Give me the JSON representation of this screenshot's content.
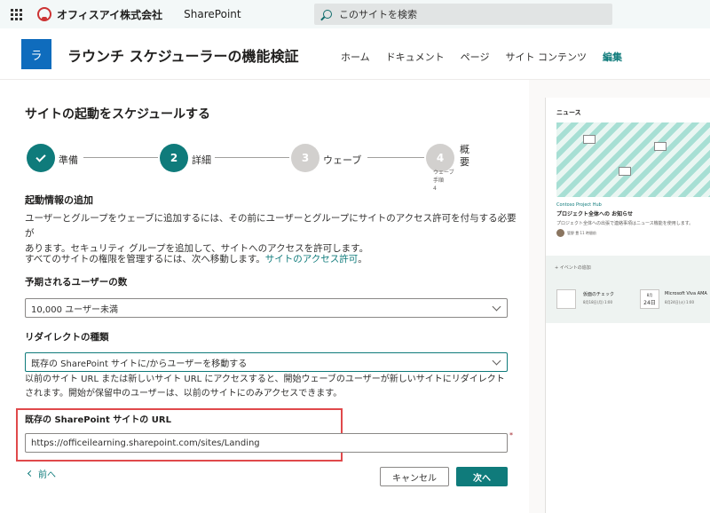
{
  "suite": {
    "org_name": "オフィスアイ株式会社",
    "app_name": "SharePoint",
    "search_placeholder": "このサイトを検索"
  },
  "site": {
    "logo_letter": "ラ",
    "title": "ラウンチ スケジューラーの機能検証",
    "nav": [
      "ホーム",
      "ドキュメント",
      "ページ",
      "サイト コンテンツ",
      "編集"
    ]
  },
  "panel": {
    "title": "サイトの起動をスケジュールする",
    "steps": [
      {
        "label": "準備",
        "state": "done",
        "number": ""
      },
      {
        "label": "詳細",
        "state": "current",
        "number": "2"
      },
      {
        "label": "ウェーブ",
        "state": "pending",
        "number": "3"
      },
      {
        "label": "概要",
        "state": "pending",
        "number": "4"
      }
    ],
    "step4_sub": "ウェーブ\n手順\n4",
    "section_title": "起動情報の追加",
    "para1_line1": "ユーザーとグループをウェーブに追加するには、その前にユーザーとグループにサイトのアクセス許可を付与する必要が",
    "para1_line2": "あります。セキュリティ グループを追加して、サイトへのアクセスを許可します。",
    "para2_prefix": "すべてのサイトの権限を管理するには、次へ移動します。",
    "para2_link": "サイトのアクセス許可",
    "para2_suffix": "。",
    "users_label": "予期されるユーザーの数",
    "users_value": "10,000 ユーザー未満",
    "redirect_label": "リダイレクトの種類",
    "redirect_value": "既存の SharePoint サイトに/からユーザーを移動する",
    "helper_line1": "以前のサイト URL または新しいサイト URL にアクセスすると、開始ウェーブのユーザーが新しいサイトにリダイレクト",
    "helper_line2": "されます。開始が保留中のユーザーは、以前のサイトにのみアクセスできます。",
    "url_label": "既存の SharePoint サイトの URL",
    "url_value": "https://officeilearning.sharepoint.com/sites/Landing",
    "required_mark": "*",
    "back_label": "前へ",
    "cancel_label": "キャンセル",
    "next_label": "次へ"
  },
  "preview": {
    "news_label": "ニュース",
    "kicker": "Contoso Project Hub",
    "headline": "プロジェクト全体への お知らせ",
    "desc": "プロジェクト全体への出張で連絡事項はニュース機能を使用します。",
    "author": "管野 豊  11 時間前",
    "add_event": "+ イベントの追加",
    "event1_title": "仮面のチェック",
    "event1_sub": "8月18日(月) 1:00",
    "event2_month": "8月",
    "event2_day": "24日",
    "event2_title": "Microsoft Viva AMA",
    "event2_sub": "8月24日(火) 1:00"
  },
  "colors": {
    "accent": "#0f7b7b",
    "highlight": "#e0494b"
  }
}
